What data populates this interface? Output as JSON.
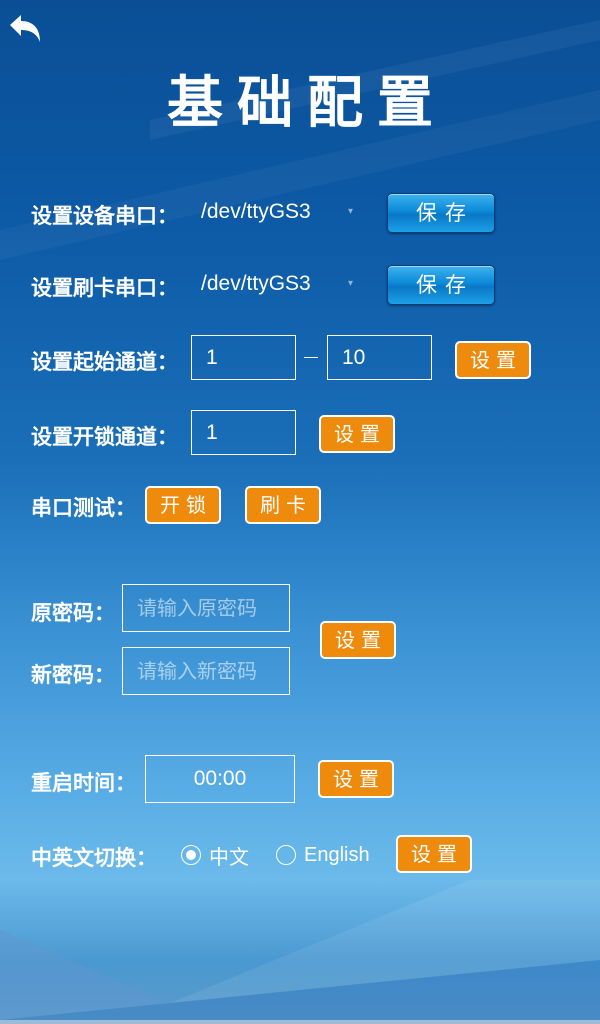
{
  "header": {
    "back_icon": "back-arrow-icon",
    "title": "基础配置"
  },
  "device_serial": {
    "label": "设置设备串口：",
    "value": "/dev/ttyGS3",
    "dropdown_icon": "dropdown-arrow-icon",
    "save_label": "保存"
  },
  "card_serial": {
    "label": "设置刷卡串口：",
    "value": "/dev/ttyGS3",
    "dropdown_icon": "dropdown-arrow-icon",
    "save_label": "保存"
  },
  "start_channel": {
    "label": "设置起始通道：",
    "from_value": "1",
    "to_value": "10",
    "set_label": "设置"
  },
  "unlock_channel": {
    "label": "设置开锁通道：",
    "value": "1",
    "set_label": "设置"
  },
  "serial_test": {
    "label": "串口测试：",
    "unlock_label": "开锁",
    "swipe_label": "刷卡"
  },
  "password": {
    "old_label": "原密码：",
    "old_placeholder": "请输入原密码",
    "new_label": "新密码：",
    "new_placeholder": "请输入新密码",
    "set_label": "设置"
  },
  "restart_time": {
    "label": "重启时间：",
    "value": "00:00",
    "set_label": "设置"
  },
  "language": {
    "label": "中英文切换：",
    "options": [
      {
        "label": "中文",
        "selected": true
      },
      {
        "label": "English",
        "selected": false
      }
    ],
    "set_label": "设置"
  }
}
